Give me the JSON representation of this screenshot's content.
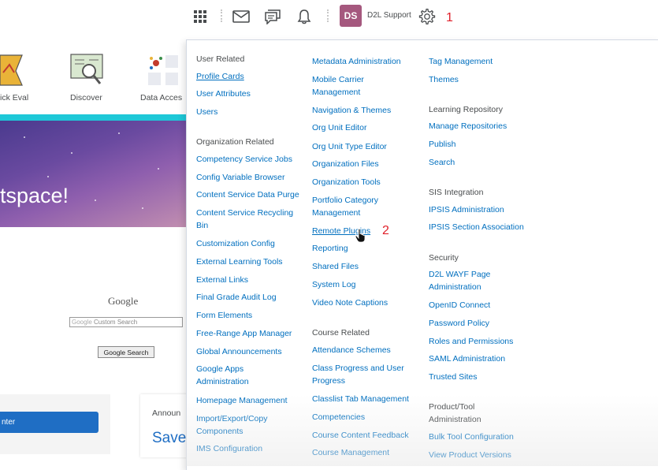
{
  "topbar": {
    "icons": [
      "waffle-grid-icon",
      "mail-icon",
      "chat-icon",
      "bell-icon",
      "gear-icon"
    ],
    "avatar_initials": "DS",
    "username": "D2L Support",
    "annotation_1": "1",
    "annotation_2": "2"
  },
  "background": {
    "tools": [
      "ick Eval",
      "Discover",
      "Data Acces"
    ],
    "banner_text": "tspace!",
    "google_logo": "Google",
    "google_input_placeholder": "Custom Search",
    "google_button": "Google Search",
    "blue_button": "nter",
    "announcements": "Announ",
    "save_text": "Save"
  },
  "menu": {
    "col1": {
      "heading1": "User Related",
      "items1": [
        "Profile Cards",
        "User Attributes",
        "Users"
      ],
      "heading2": "Organization Related",
      "items2": [
        "Competency Service Jobs",
        "Config Variable Browser",
        "Content Service Data Purge",
        "Content Service Recycling",
        "Bin",
        "Customization Config",
        "External Learning Tools",
        "External Links",
        "Final Grade Audit Log",
        "Form Elements",
        "Free-Range App Manager",
        "Global Announcements",
        "Google Apps",
        "Administration",
        "Homepage Management",
        "Import/Export/Copy",
        "Components",
        "IMS Configuration"
      ]
    },
    "col2": {
      "items1": [
        "Metadata Administration",
        "Mobile Carrier",
        "Management",
        "Navigation & Themes",
        "Org Unit Editor",
        "Org Unit Type Editor",
        "Organization Files",
        "Organization Tools",
        "Portfolio Category",
        "Management",
        "Remote Plugins",
        "Reporting",
        "Shared Files",
        "System Log",
        "Video Note Captions"
      ],
      "heading": "Course Related",
      "items2": [
        "Attendance Schemes",
        "Class Progress and User",
        "Progress",
        "Classlist Tab Management",
        "Competencies",
        "Course Content Feedback",
        "Course Management"
      ]
    },
    "col3": {
      "items1": [
        "Tag Management",
        "Themes"
      ],
      "heading1": "Learning Repository",
      "items2": [
        "Manage Repositories",
        "Publish",
        "Search"
      ],
      "heading2": "SIS Integration",
      "items3": [
        "IPSIS Administration",
        "IPSIS Section Association"
      ],
      "heading3": "Security",
      "items4": [
        "D2L WAYF Page",
        "Administration",
        "OpenID Connect",
        "Password Policy",
        "Roles and Permissions",
        "SAML Administration",
        "Trusted Sites"
      ],
      "heading4a": "Product/Tool",
      "heading4b": "Administration",
      "items5": [
        "Bulk Tool Configuration",
        "View Product Versions"
      ]
    }
  },
  "colors": {
    "link": "#006fbf",
    "annotation": "#e0202a",
    "avatar": "#a5587e",
    "teal": "#1ec8d8"
  }
}
